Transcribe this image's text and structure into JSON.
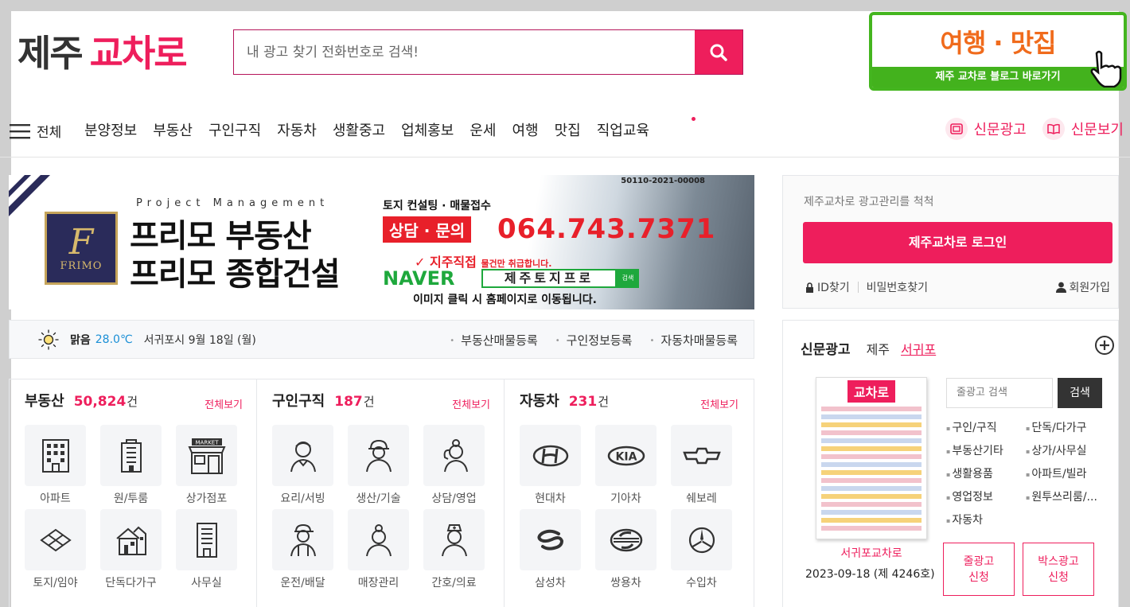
{
  "header": {
    "logo_part1": "제주",
    "logo_part2": "교차로",
    "search_placeholder": "내 광고 찾기 전화번호로 검색!",
    "blog_banner_title": "여행 · 맛집",
    "blog_banner_sub": "제주 교차로 블로그 바로가기"
  },
  "nav": {
    "menu_label": "전체",
    "items": [
      "분양정보",
      "부동산",
      "구인구직",
      "자동차",
      "생활중고",
      "업체홍보",
      "운세",
      "여행",
      "맛집",
      "직업교육"
    ],
    "right_items": [
      "신문광고",
      "신문보기"
    ]
  },
  "ad": {
    "project": "Project Management",
    "line1": "프리모 부동산",
    "line2": "프리모 종합건설",
    "brand": "FRIMO",
    "reg_no": "50110-2021-00008",
    "consult": "토지 컨설팅 · 매물접수",
    "inquiry": "상담 · 문의",
    "phone": "064.743.7371",
    "direct": "✓ 지주직접",
    "direct_sub": "물건만 취급합니다.",
    "naver": "NAVER",
    "naver_query": "제주토지프로",
    "naver_btn": "검색",
    "click_hint": "이미지 클릭 시 홈페이지로 이동됩니다."
  },
  "weather": {
    "condition": "맑음",
    "temp": "28.0℃",
    "location_date": "서귀포시 9월 18일 (월)",
    "links": [
      "부동산매물등록",
      "구인정보등록",
      "자동차매물등록"
    ]
  },
  "categories": [
    {
      "name": "부동산",
      "count": "50,824",
      "unit": "건",
      "all": "전체보기",
      "tiles": [
        "아파트",
        "원/투룸",
        "상가점포",
        "토지/임야",
        "단독다가구",
        "사무실"
      ]
    },
    {
      "name": "구인구직",
      "count": "187",
      "unit": "건",
      "all": "전체보기",
      "tiles": [
        "요리/서빙",
        "생산/기술",
        "상담/영업",
        "운전/배달",
        "매장관리",
        "간호/의료"
      ]
    },
    {
      "name": "자동차",
      "count": "231",
      "unit": "건",
      "all": "전체보기",
      "tiles": [
        "현대차",
        "기아차",
        "쉐보레",
        "삼성차",
        "쌍용차",
        "수입차"
      ]
    }
  ],
  "login": {
    "info": "제주교차로 광고관리를 척척",
    "button": "제주교차로 로그인",
    "find_id": "ID찾기",
    "find_pw": "비밀번호찾기",
    "join": "회원가입"
  },
  "paper": {
    "title": "신문광고",
    "tab1": "제주",
    "tab2": "서귀포",
    "masthead": "교차로",
    "name": "서귀포교차로",
    "date": "2023-09-18 (제 4246호)",
    "search_placeholder": "줄광고 검색",
    "search_btn": "검색",
    "links": [
      "구인/구직",
      "단독/다가구",
      "부동산기타",
      "상가/사무실",
      "생활용품",
      "아파트/빌라",
      "영업정보",
      "원투쓰리룸/...",
      "자동차"
    ],
    "apply1_l1": "줄광고",
    "apply1_l2": "신청",
    "apply2_l1": "박스광고",
    "apply2_l2": "신청"
  },
  "colors": {
    "brand": "#ee1e5c",
    "weather_temp": "#1a8fd6",
    "blog_green": "#44b51f"
  }
}
